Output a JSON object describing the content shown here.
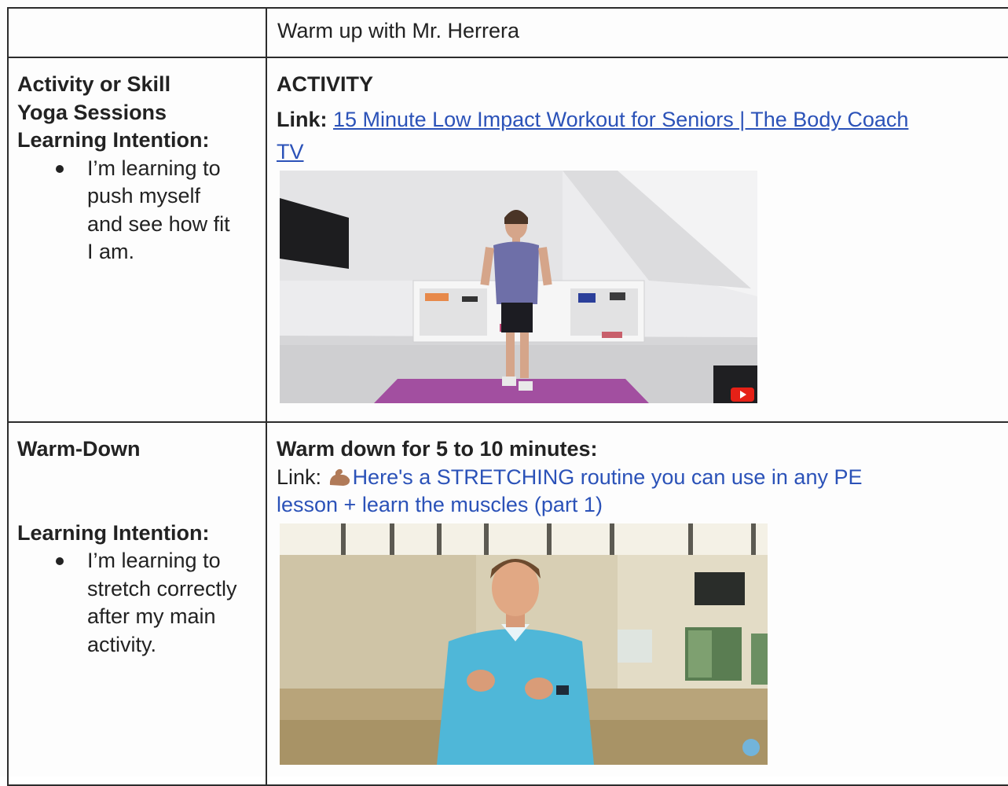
{
  "header": {
    "left": "",
    "right": "Warm up with Mr. Herrera"
  },
  "activity_row": {
    "left_title_1": "Activity or Skill",
    "left_title_2": "Yoga Sessions",
    "intention_label": "Learning Intention:",
    "intention_lines": [
      "I’m learning to",
      "push myself",
      "and see how fit",
      "I am."
    ],
    "heading": "ACTIVITY",
    "link_label": "Link:",
    "link_text_1": "15 Minute Low Impact Workout for Seniors | The Body Coach",
    "link_text_2": "TV",
    "thumbnail_icon": "youtube-play-icon"
  },
  "warmdown_row": {
    "left_title": "Warm-Down",
    "intention_label": "Learning Intention:",
    "intention_lines": [
      "I’m learning to",
      "stretch correctly",
      "after my main",
      "activity."
    ],
    "heading": "Warm down for 5 to 10 minutes:",
    "link_label": "Link:",
    "link_icon": "flexed-biceps-icon",
    "link_text_1": "Here's a STRETCHING routine you can use in any PE",
    "link_text_2": "lesson + learn the muscles (part 1)"
  },
  "colors": {
    "link": "#2b52b8",
    "border": "#2c2c2c",
    "mat": "#a24fa0",
    "shirt_1": "#6e6fa8",
    "shirt_2": "#4fb7d8",
    "youtube_red": "#e62117"
  }
}
